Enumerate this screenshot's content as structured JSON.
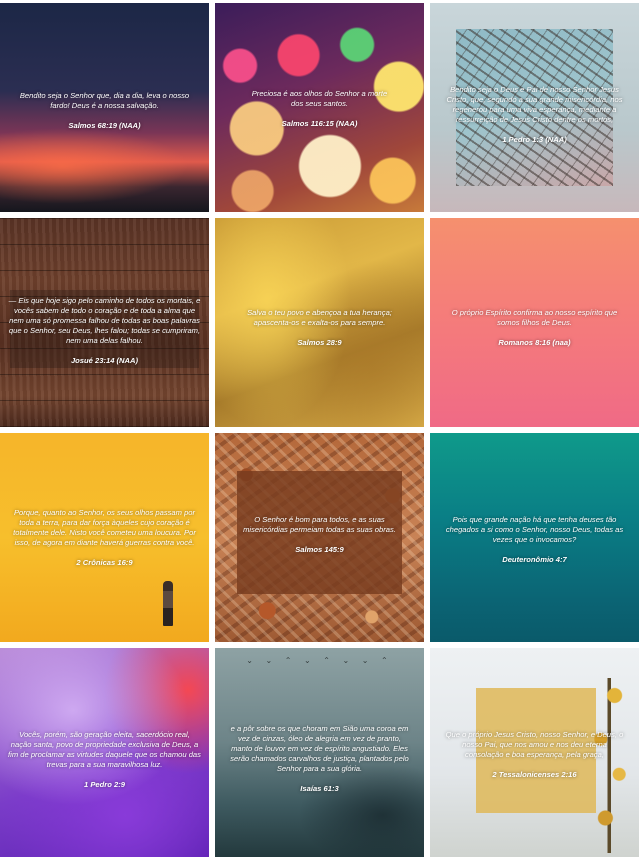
{
  "tiles": [
    {
      "quote": "Bendito seja o Senhor que, dia a dia, leva o nosso fardo! Deus é a nossa salvação.",
      "ref": "Salmos 68:19 (NAA)"
    },
    {
      "quote": "Preciosa é aos olhos do Senhor a morte dos seus santos.",
      "ref": "Salmos 116:15 (NAA)"
    },
    {
      "quote": "Bendito seja o Deus e Pai de nosso Senhor Jesus Cristo, que, segundo a sua grande misericórdia, nos regenerou para uma viva esperança, mediante a ressurreição de Jesus Cristo dentre os mortos,",
      "ref": "1 Pedro 1:3 (NAA)"
    },
    {
      "quote": "— Eis que hoje sigo pelo caminho de todos os mortais, e vocês sabem de todo o coração e de toda a alma que nem uma só promessa falhou de todas as boas palavras que o Senhor, seu Deus, lhes falou; todas se cumpriram, nem uma delas falhou.",
      "ref": "Josué 23:14 (NAA)"
    },
    {
      "quote": "Salva o teu povo e abençoa a tua herança; apascenta-os e exalta-os para sempre.",
      "ref": "Salmos 28:9"
    },
    {
      "quote": "O próprio Espírito confirma ao nosso espírito que somos filhos de Deus.",
      "ref": "Romanos 8:16 (naa)"
    },
    {
      "quote": "Porque, quanto ao Senhor, os seus olhos passam por toda a terra, para dar força àqueles cujo coração é totalmente dele. Nisto você cometeu uma loucura. Por isso, de agora em diante haverá guerras contra você.",
      "ref": "2 Crônicas 16:9"
    },
    {
      "quote": "O Senhor é bom para todos, e as suas misericórdias permeiam todas as suas obras.",
      "ref": "Salmos 145:9"
    },
    {
      "quote": "Pois que grande nação há que tenha deuses tão chegados a si como o Senhor, nosso Deus, todas as vezes que o invocamos?",
      "ref": "Deuteronômio 4:7"
    },
    {
      "quote": "Vocês, porém, são geração eleita, sacerdócio real, nação santa, povo de propriedade exclusiva de Deus, a fim de proclamar as virtudes daquele que os chamou das trevas para a sua maravilhosa luz.",
      "ref": "1 Pedro 2:9"
    },
    {
      "quote": "e a pôr sobre os que choram em Sião uma coroa em vez de cinzas, óleo de alegria em vez de pranto, manto de louvor em vez de espírito angustiado. Eles serão chamados carvalhos de justiça, plantados pelo Senhor para a sua glória.",
      "ref": "Isaías 61:3"
    },
    {
      "quote": "Que o próprio Jesus Cristo, nosso Senhor, e Deus, o nosso Pai, que nos amou e nos deu eterna consolação e boa esperança, pela graça,",
      "ref": "2 Tessalonicenses 2:16"
    }
  ],
  "icons": {
    "person": "person-silhouette-icon",
    "birds": "birds-flock-icon",
    "plant": "yellow-flower-branch-icon"
  },
  "glyphs": {
    "birds": "⌄ ⌄ ⌃ ⌄ ⌃ ⌄ ⌄ ⌃"
  }
}
